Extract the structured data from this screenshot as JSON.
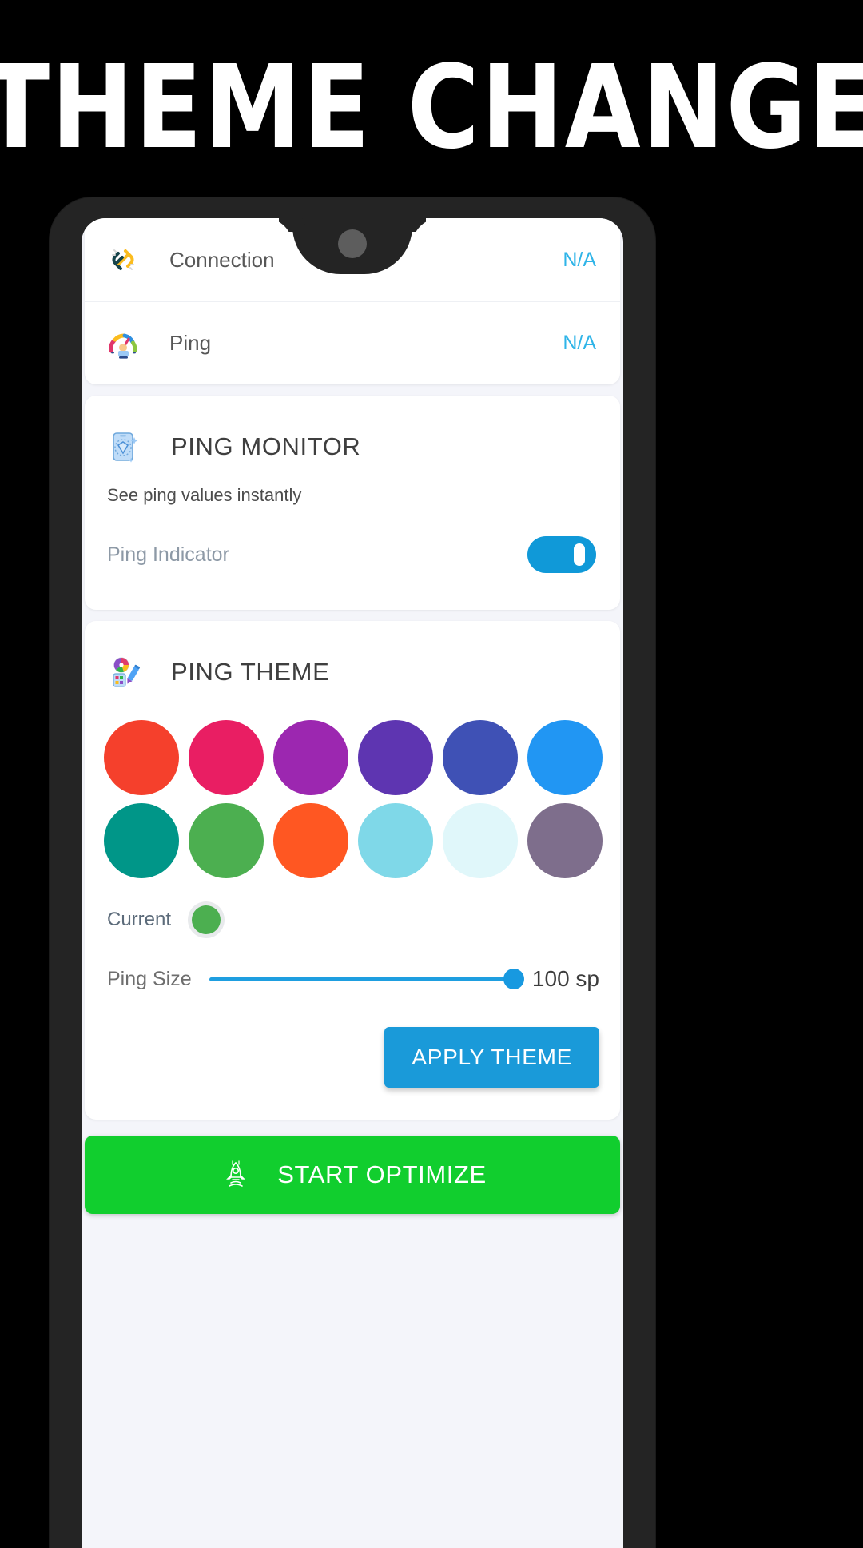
{
  "headline": "THEME CHANGER",
  "phone": {
    "status_card": {
      "rows": [
        {
          "icon": "link-chain-icon",
          "label": "Connection",
          "value": "N/A"
        },
        {
          "icon": "speedometer-icon",
          "label": "Ping",
          "value": "N/A"
        }
      ]
    },
    "ping_monitor": {
      "icon": "phone-shield-icon",
      "title": "PING MONITOR",
      "subtitle": "See ping values instantly",
      "toggle_label": "Ping Indicator",
      "toggle_state": "on",
      "toggle_color": "#1099d8"
    },
    "ping_theme": {
      "icon": "color-palette-icon",
      "title": "PING THEME",
      "swatches": [
        {
          "name": "red",
          "color": "#F5402C"
        },
        {
          "name": "pink",
          "color": "#E91E63"
        },
        {
          "name": "purple",
          "color": "#9C27B0"
        },
        {
          "name": "deep-purple",
          "color": "#5E35B1"
        },
        {
          "name": "indigo",
          "color": "#3F51B5"
        },
        {
          "name": "blue",
          "color": "#2196F3"
        },
        {
          "name": "teal",
          "color": "#009688"
        },
        {
          "name": "green",
          "color": "#4CAF50"
        },
        {
          "name": "deep-orange",
          "color": "#FF5722"
        },
        {
          "name": "light-cyan",
          "color": "#7FD8E8"
        },
        {
          "name": "pale-cyan",
          "color": "#E0F7FA"
        },
        {
          "name": "gray-purple",
          "color": "#7E6E8C"
        }
      ],
      "current_label": "Current",
      "current_color": "#4CAF50",
      "size_label": "Ping Size",
      "size_value": "100 sp",
      "size_percent": 100,
      "apply_label": "APPLY THEME",
      "apply_color": "#1a9ad9"
    },
    "optimize": {
      "icon": "rocket-icon",
      "label": "START OPTIMIZE",
      "color": "#11ce2e"
    }
  }
}
